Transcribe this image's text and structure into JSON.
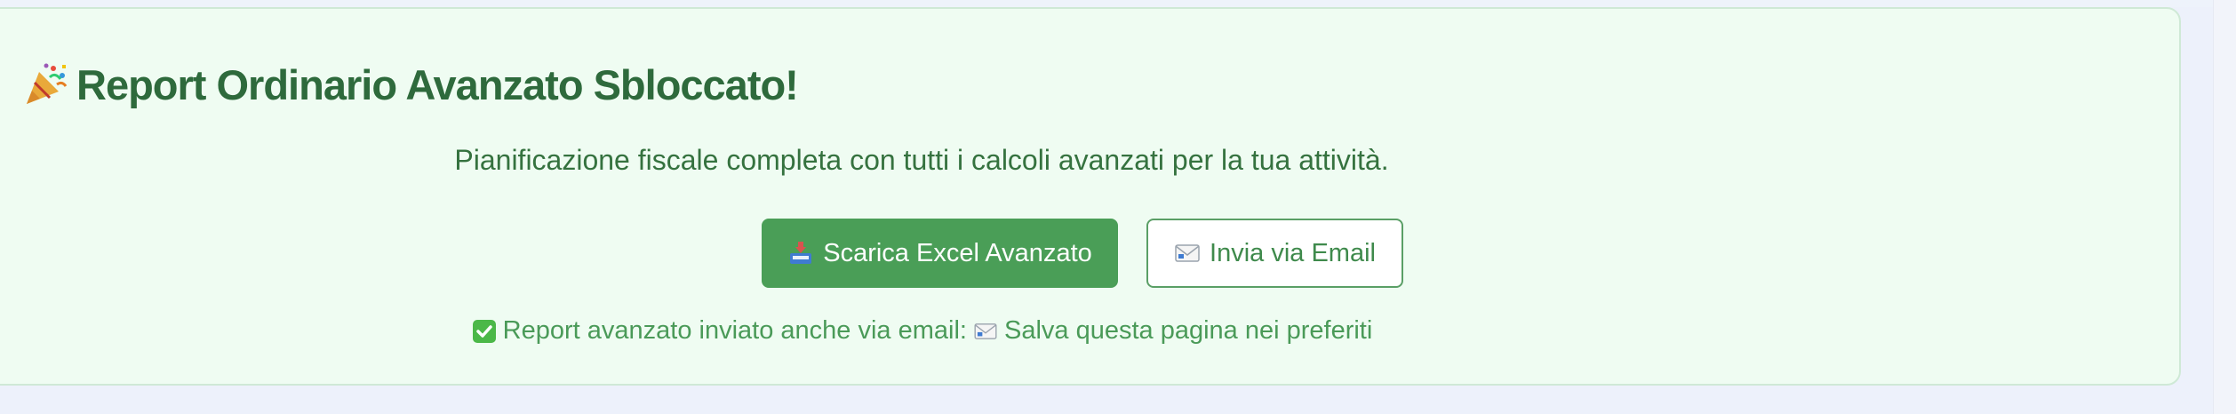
{
  "card": {
    "title": "Report Ordinario Avanzato Sbloccato!",
    "title_icon": "party-popper-icon",
    "subtitle": "Pianificazione fiscale completa con tutti i calcoli avanzati per la tua attività."
  },
  "actions": {
    "download_label": "Scarica Excel Avanzato",
    "download_icon": "inbox-tray-icon",
    "email_label": "Invia via Email",
    "email_icon": "envelope-icon"
  },
  "note": {
    "check_icon": "check-mark-icon",
    "part1": "Report avanzato inviato anche via email:",
    "envelope_icon": "envelope-icon",
    "part2": "Salva questa pagina nei preferiti"
  },
  "colors": {
    "card_bg": "#effcf2",
    "title": "#2e6a3c",
    "primary_button": "#4a9e57",
    "secondary_border": "#5a9f66",
    "check_green": "#4bb848"
  }
}
